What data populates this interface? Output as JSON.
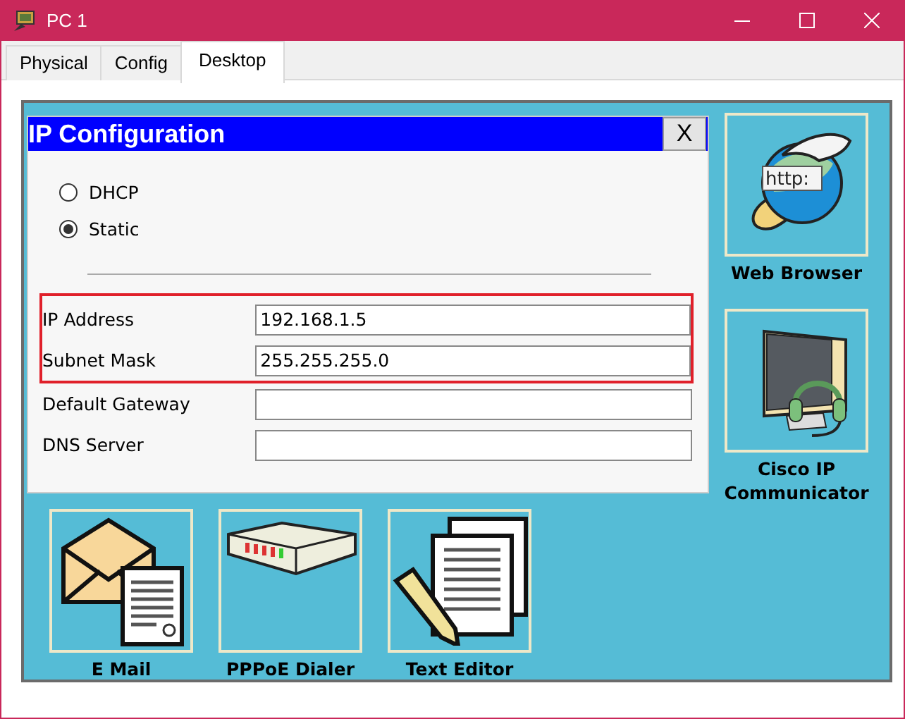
{
  "window": {
    "title": "PC 1"
  },
  "tabs": [
    {
      "label": "Physical",
      "selected": false
    },
    {
      "label": "Config",
      "selected": false
    },
    {
      "label": "Desktop",
      "selected": true
    }
  ],
  "dialog": {
    "title": "IP Configuration",
    "close_label": "X",
    "modes": [
      {
        "label": "DHCP",
        "selected": false
      },
      {
        "label": "Static",
        "selected": true
      }
    ],
    "fields": [
      {
        "label": "IP Address",
        "value": "192.168.1.5",
        "highlighted": true
      },
      {
        "label": "Subnet Mask",
        "value": "255.255.255.0",
        "highlighted": true
      },
      {
        "label": "Default Gateway",
        "highlighted": false
      },
      {
        "label": "DNS Server",
        "highlighted": false
      }
    ]
  },
  "apps": [
    {
      "label": "Web Browser",
      "kind": "browser",
      "badge": "http:"
    },
    {
      "label": "Cisco IP Communicator",
      "kind": "phone"
    },
    {
      "label": "E Mail",
      "kind": "mail"
    },
    {
      "label": "PPPoE Dialer",
      "kind": "dialer"
    },
    {
      "label": "Text Editor",
      "kind": "editor"
    }
  ]
}
